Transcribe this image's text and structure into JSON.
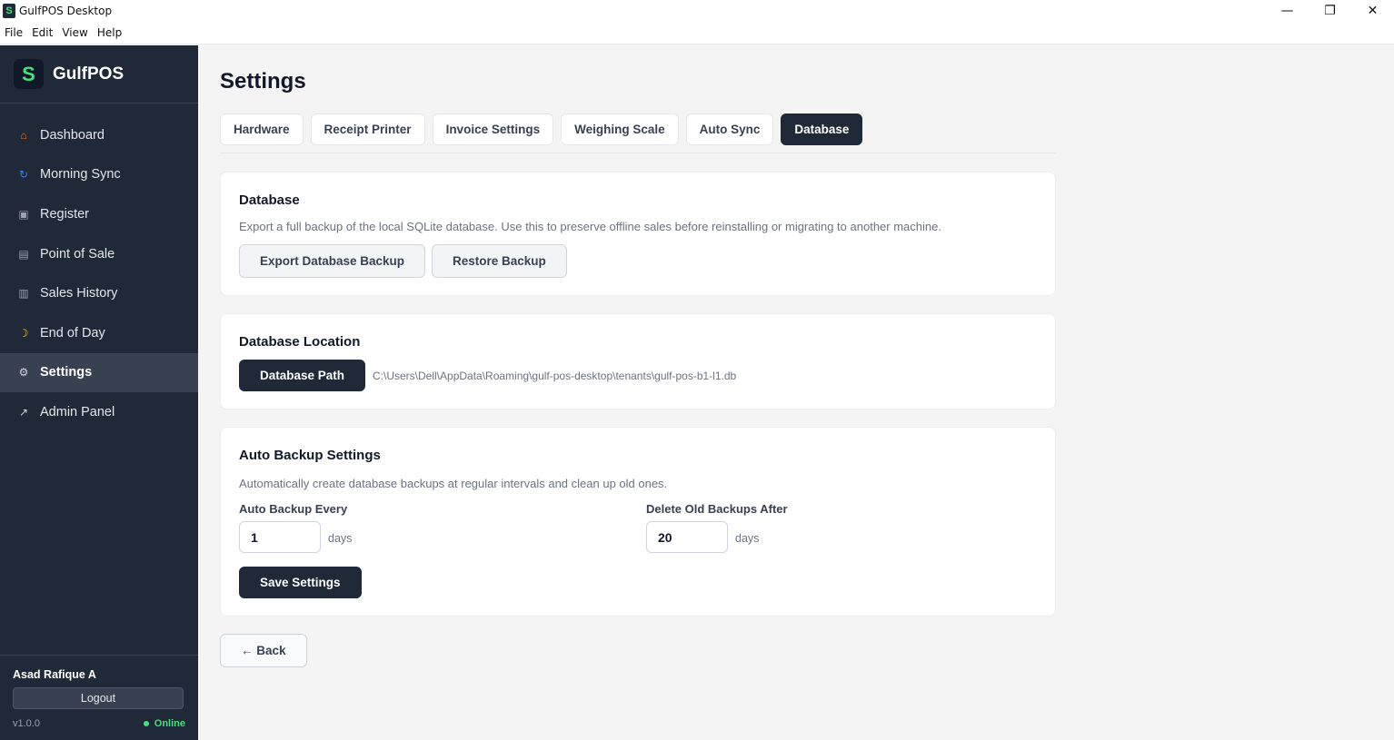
{
  "window": {
    "title": "GulfPOS Desktop",
    "app_icon": "S",
    "controls": [
      "minimize-icon",
      "restore-icon",
      "close-icon"
    ],
    "minimize_glyph": "—",
    "restore_glyph": "❐",
    "close_glyph": "✕"
  },
  "menu": [
    "File",
    "Edit",
    "View",
    "Help"
  ],
  "sidebar": {
    "brand": "GulfPOS",
    "logo_letter": "S",
    "items": [
      {
        "label": "Dashboard",
        "icon": "home-icon",
        "glyph": "⌂",
        "color": "#f97316"
      },
      {
        "label": "Morning Sync",
        "icon": "sync-icon",
        "glyph": "↻",
        "color": "#3b82f6"
      },
      {
        "label": "Register",
        "icon": "register-icon",
        "glyph": "▣",
        "color": "#9ca3af"
      },
      {
        "label": "Point of Sale",
        "icon": "cart-icon",
        "glyph": "▤",
        "color": "#9ca3af"
      },
      {
        "label": "Sales History",
        "icon": "receipt-icon",
        "glyph": "▥",
        "color": "#9ca3af"
      },
      {
        "label": "End of Day",
        "icon": "moon-icon",
        "glyph": "☽",
        "color": "#facc15"
      },
      {
        "label": "Settings",
        "icon": "gear-icon",
        "glyph": "⚙",
        "color": "#d1d5db"
      },
      {
        "label": "Admin Panel",
        "icon": "external-link-icon",
        "glyph": "↗",
        "color": "#d1d5db"
      }
    ],
    "user": "Asad Rafique A",
    "logout": "Logout",
    "version": "v1.0.0",
    "status": "Online",
    "status_color": "#4ade80"
  },
  "page": {
    "title": "Settings",
    "tabs": [
      "Hardware",
      "Receipt Printer",
      "Invoice Settings",
      "Weighing Scale",
      "Auto Sync",
      "Database"
    ],
    "active_tab": "Database"
  },
  "database_card": {
    "title": "Database",
    "description": "Export a full backup of the local SQLite database. Use this to preserve offline sales before reinstalling or migrating to another machine.",
    "export_button": "Export Database Backup",
    "restore_button": "Restore Backup"
  },
  "location_card": {
    "title": "Database Location",
    "path_button": "Database Path",
    "path": "C:\\Users\\Dell\\AppData\\Roaming\\gulf-pos-desktop\\tenants\\gulf-pos-b1-l1.db"
  },
  "auto_backup_card": {
    "title": "Auto Backup Settings",
    "description": "Automatically create database backups at regular intervals and clean up old ones.",
    "backup_every_label": "Auto Backup Every",
    "backup_every_value": "1",
    "backup_every_unit": "days",
    "delete_after_label": "Delete Old Backups After",
    "delete_after_value": "20",
    "delete_after_unit": "days",
    "save_button": "Save Settings"
  },
  "back_button": "← Back"
}
